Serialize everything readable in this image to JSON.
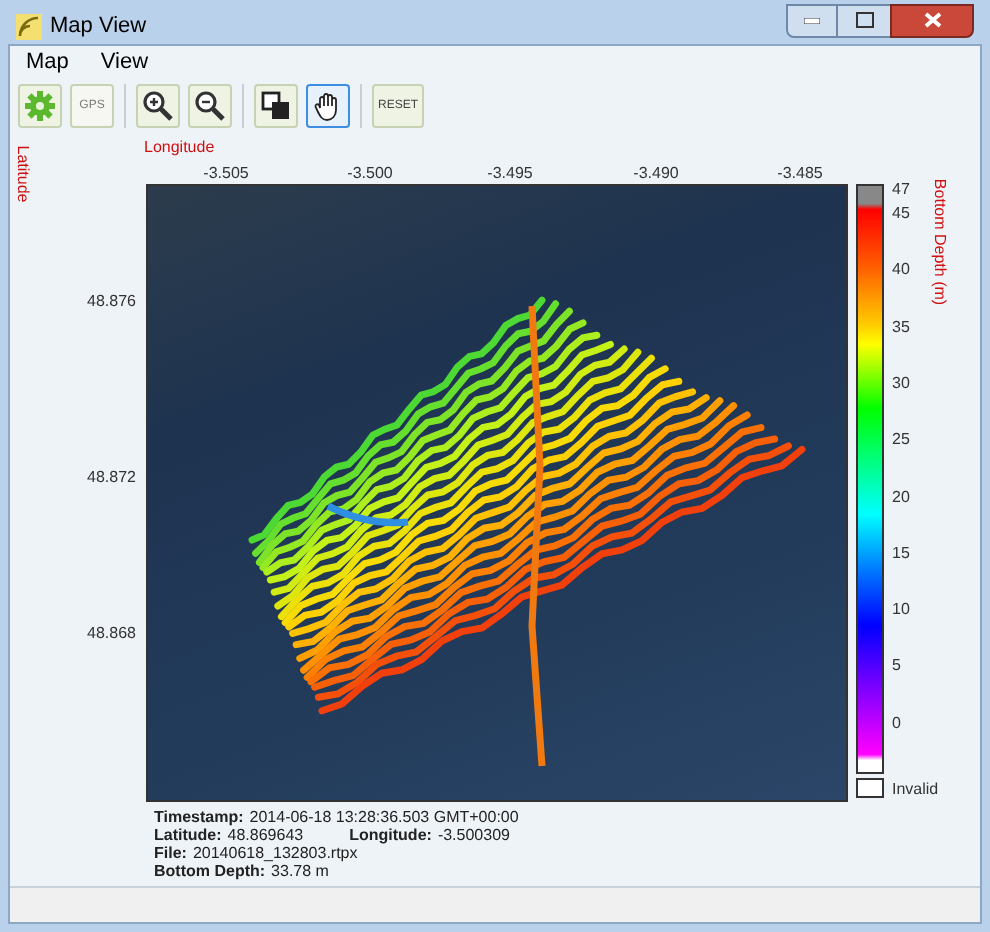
{
  "window": {
    "title": "Map View"
  },
  "menu": [
    "Map",
    "View"
  ],
  "toolbar": [
    {
      "kind": "gear",
      "selected": false,
      "disabled": false
    },
    {
      "kind": "text",
      "label": "GPS",
      "selected": false,
      "disabled": true
    },
    {
      "kind": "zoom-in",
      "selected": false,
      "disabled": false
    },
    {
      "kind": "zoom-out",
      "selected": false,
      "disabled": false
    },
    {
      "kind": "layers",
      "selected": false,
      "disabled": false
    },
    {
      "kind": "hand",
      "selected": true,
      "disabled": false
    },
    {
      "kind": "text",
      "label": "RESET",
      "selected": false,
      "disabled": false
    }
  ],
  "plot": {
    "x_axis_label": "Longitude",
    "y_axis_label": "Latitude",
    "x_ticks": [
      "-3.505",
      "-3.500",
      "-3.495",
      "-3.490",
      "-3.485"
    ],
    "y_ticks": [
      "48.876",
      "48.872",
      "48.868"
    ],
    "colorbar": {
      "label": "Bottom Depth (m)",
      "ticks": [
        "47",
        "45",
        "40",
        "35",
        "30",
        "25",
        "20",
        "15",
        "10",
        "5",
        "0"
      ],
      "invalid_label": "Invalid"
    }
  },
  "info": [
    {
      "label": "Timestamp:",
      "value": "2014-06-18 13:28:36.503 GMT+00:00"
    },
    {
      "label": "Latitude:",
      "value": "48.869643",
      "label2": "Longitude:",
      "value2": "-3.500309"
    },
    {
      "label": "File:",
      "value": "20140618_132803.rtpx"
    },
    {
      "label": "Bottom Depth:",
      "value": "33.78 m"
    }
  ]
}
